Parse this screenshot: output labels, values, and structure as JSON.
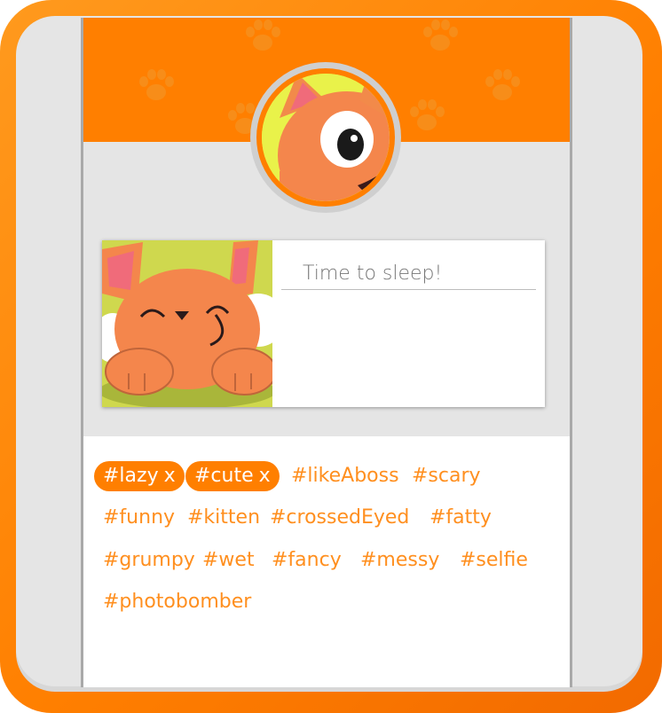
{
  "colors": {
    "accent": "#ff7f00",
    "tag_text": "#ff8f1f",
    "background": "#e5e5e5"
  },
  "header": {
    "avatar_icon": "orange-fox-cat-avatar"
  },
  "post": {
    "photo_icon": "sleepy-orange-cat-photo",
    "caption_placeholder": "Time to sleep!"
  },
  "tags": {
    "selected": [
      {
        "label": "#lazy",
        "remove": "x"
      },
      {
        "label": "#cute",
        "remove": "x"
      }
    ],
    "rows": [
      [
        "#likeAboss",
        "#scary"
      ],
      [
        "#funny",
        "#kitten",
        "#crossedEyed",
        "#fatty"
      ],
      [
        "#grumpy",
        "#wet",
        "#fancy",
        "#messy",
        "#selfie"
      ],
      [
        "#photobomber"
      ]
    ]
  }
}
